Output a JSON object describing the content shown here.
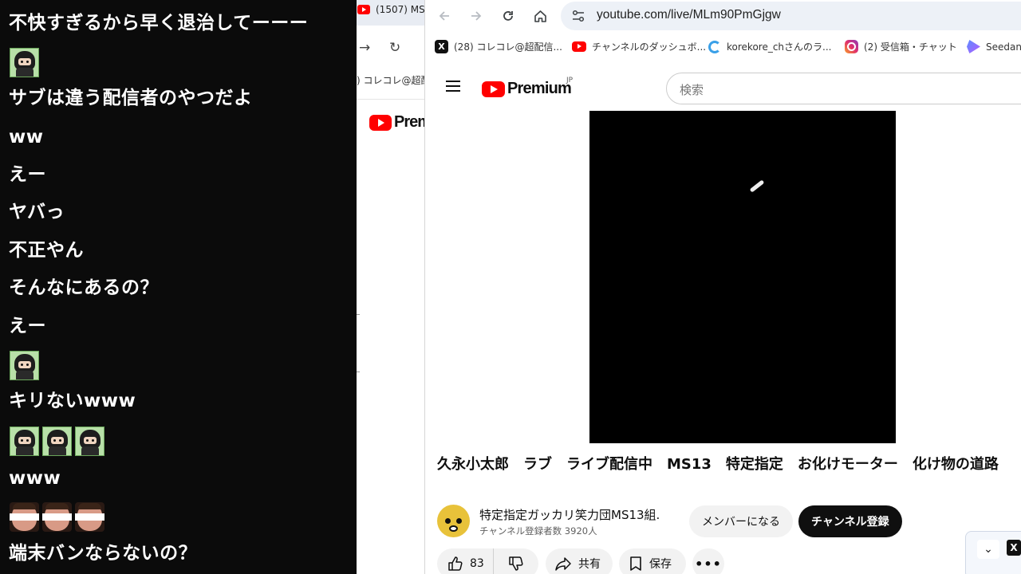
{
  "chat": {
    "messages": [
      "不快すぎるから早く退治してーーー",
      "サブは違う配信者のやつだよ",
      "ww",
      "えー",
      "ヤバっ",
      "不正やん",
      "そんなにあるの？",
      "えー",
      "キリないwww",
      "www",
      "端末バンならないの？"
    ],
    "stamps": {
      "row1": [
        "ninja-stamp"
      ],
      "row2": [
        "ninja-stamp"
      ],
      "row3": [
        "ninja-stamp",
        "ninja-stamp",
        "ninja-stamp"
      ],
      "row4": [
        "censored-face-stamp",
        "censored-face-stamp",
        "censored-face-stamp"
      ]
    }
  },
  "background_window": {
    "tab_title": "(1507) MS",
    "bookmark_fragment": ") コレコレ@超配",
    "logo_text": "Prem"
  },
  "browser": {
    "url": "youtube.com/live/MLm90PmGjgw",
    "icons": {
      "back": "back-arrow-icon",
      "forward": "forward-arrow-icon",
      "reload": "reload-icon",
      "home": "home-icon",
      "site_info": "site-settings-icon"
    },
    "bookmarks": [
      {
        "label": "(28) コレコレ@超配信...",
        "icon": "x-icon"
      },
      {
        "label": "チャンネルのダッシュボ...",
        "icon": "youtube-icon"
      },
      {
        "label": "korekore_chさんのラ...",
        "icon": "korekore-icon"
      },
      {
        "label": "(2) 受信箱・チャット",
        "icon": "instagram-icon"
      },
      {
        "label": "Seedance",
        "icon": "seedance-icon"
      }
    ]
  },
  "youtube": {
    "logo_text": "Premium",
    "logo_region": "JP",
    "search_placeholder": "検索",
    "video": {
      "title": "久永小太郎　ラブ　ライブ配信中　MS13　特定指定　お化けモーター　化け物の道路"
    },
    "channel": {
      "name": "特定指定ガッカリ笑力団MS13組.",
      "subscribers": "チャンネル登録者数 3920人",
      "member_button": "メンバーになる",
      "subscribe_button": "チャンネル登録"
    },
    "actions": {
      "like_count": "83",
      "share_label": "共有",
      "save_label": "保存",
      "more_label": "•••"
    }
  },
  "colors": {
    "brand_red": "#ff0000",
    "chat_bg": "#0b0b0b",
    "chip_bg": "#f2f2f2"
  }
}
